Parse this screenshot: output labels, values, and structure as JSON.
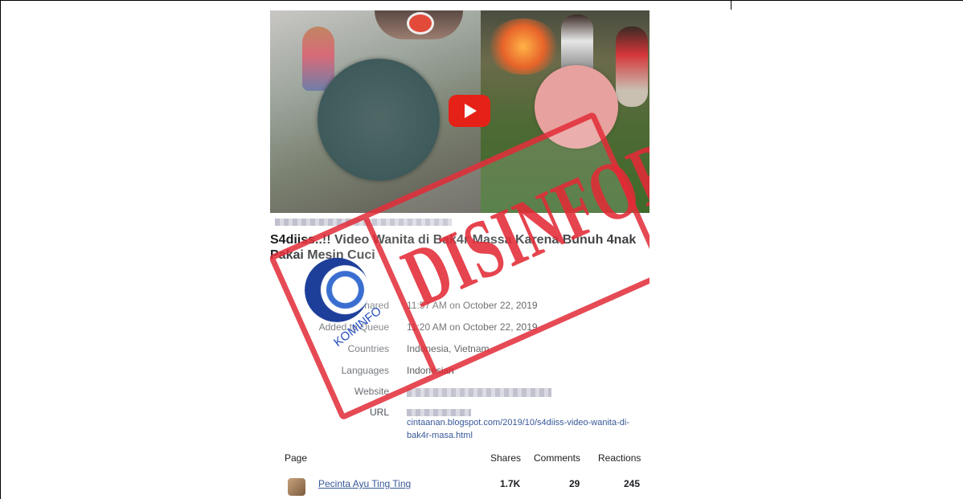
{
  "post": {
    "title": "S4diiss..!! Video Wanita di Bak4r Massa Karena Bunuh 4nak Pakai Mesin Cuci",
    "meta": [
      {
        "label": "Shared",
        "value": "11:57 AM on October 22, 2019"
      },
      {
        "label": "Added to Queue",
        "value": "11:20 AM on October 22, 2019"
      },
      {
        "label": "Countries",
        "value": "Indonesia, Vietnam"
      },
      {
        "label": "Languages",
        "value": "Indonesian"
      },
      {
        "label": "Website",
        "value": ""
      },
      {
        "label": "URL",
        "value": ""
      }
    ],
    "url_text": "cintaanan.blogspot.com/2019/10/s4diiss-video-wanita-di-bak4r-masa.html"
  },
  "table": {
    "headers": {
      "page": "Page",
      "shares": "Shares",
      "comments": "Comments",
      "reactions": "Reactions"
    },
    "rows": [
      {
        "page": "Pecinta Ayu Ting Ting",
        "shares": "1.7K",
        "comments": "29",
        "reactions": "245"
      }
    ]
  },
  "stamp": {
    "text": "DISINFORMASI",
    "logo_text": "KOMINFO",
    "color": "#e22a36"
  },
  "icons": [
    "play-icon",
    "kominfo-logo"
  ],
  "colors": {
    "accent": "#e62117",
    "link": "#365899"
  }
}
